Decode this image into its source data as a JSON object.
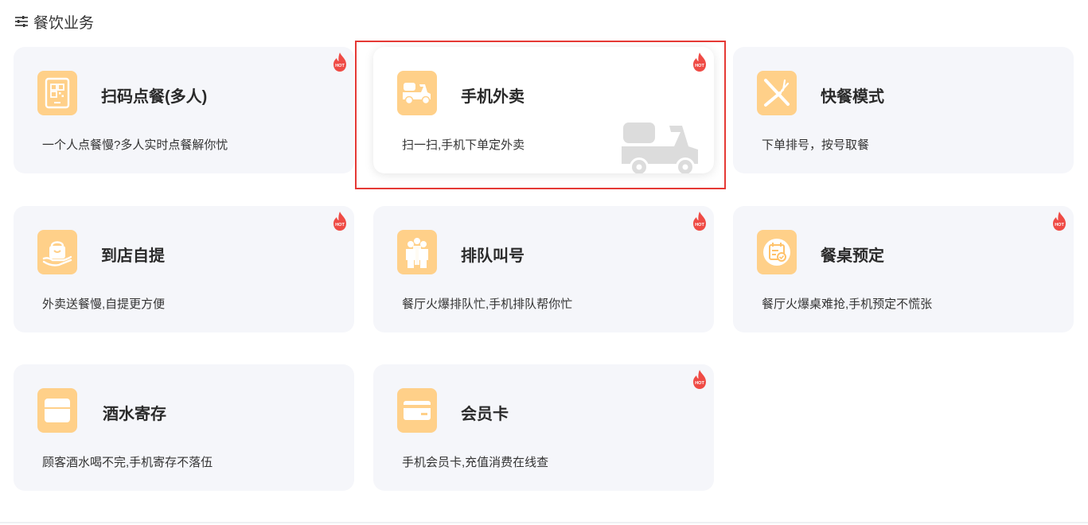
{
  "section": {
    "title": "餐饮业务",
    "icon": "sliders-icon"
  },
  "hot_label": "HOT",
  "colors": {
    "card_bg": "#f5f6fa",
    "icon_bg": "#ffd089",
    "hot_red": "#ef4b45",
    "highlight_border": "#e53935"
  },
  "cards": [
    {
      "title": "扫码点餐(多人)",
      "desc": "一个人点餐慢?多人实时点餐解你忧",
      "icon": "qr-tablet-icon",
      "hot": true
    },
    {
      "title": "手机外卖",
      "desc": "扫一扫,手机下单定外卖",
      "icon": "scooter-icon",
      "hot": true,
      "selected": true
    },
    {
      "title": "快餐模式",
      "desc": "下单排号，按号取餐",
      "icon": "fork-knife-icon",
      "hot": false
    },
    {
      "title": "到店自提",
      "desc": "外卖送餐慢,自提更方便",
      "icon": "hand-bag-icon",
      "hot": true
    },
    {
      "title": "排队叫号",
      "desc": "餐厅火爆排队忙,手机排队帮你忙",
      "icon": "people-queue-icon",
      "hot": true
    },
    {
      "title": "餐桌预定",
      "desc": "餐厅火爆桌难抢,手机预定不慌张",
      "icon": "calendar-check-icon",
      "hot": true
    },
    {
      "title": "酒水寄存",
      "desc": "顾客酒水喝不完,手机寄存不落伍",
      "icon": "storage-box-icon",
      "hot": false
    },
    {
      "title": "会员卡",
      "desc": "手机会员卡,充值消费在线查",
      "icon": "member-card-icon",
      "hot": true
    }
  ]
}
